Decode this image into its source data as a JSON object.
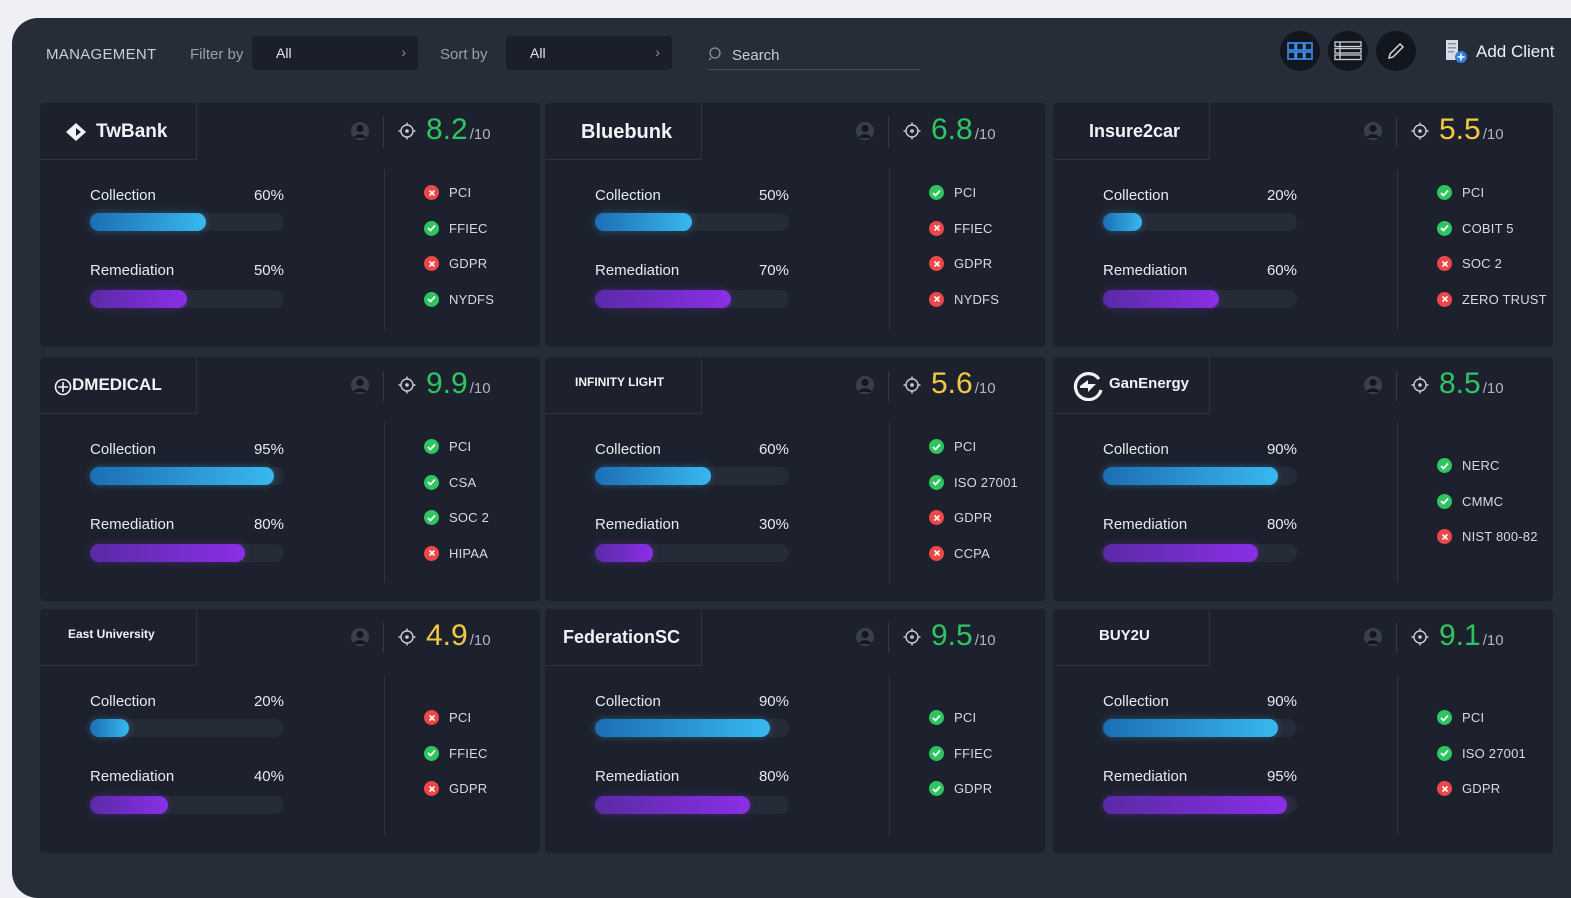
{
  "header": {
    "title": "MANAGEMENT",
    "filter_label": "Filter by",
    "filter_value": "All",
    "sort_label": "Sort by",
    "sort_value": "All",
    "search_placeholder": "Search",
    "add_client": "Add Client"
  },
  "colors": {
    "green": "#2ec561",
    "yellow": "#f3c941",
    "ok": "#2ec561",
    "fail": "#ef4747"
  },
  "score_suffix": "/10",
  "collection_label": "Collection",
  "remediation_label": "Remediation",
  "clients": [
    {
      "logo": "TwBank",
      "score": "8.2",
      "score_color": "green",
      "collection": "60%",
      "remediation": "50%",
      "frameworks": [
        {
          "name": "PCI",
          "status": "fail"
        },
        {
          "name": "FFIEC",
          "status": "ok"
        },
        {
          "name": "GDPR",
          "status": "fail"
        },
        {
          "name": "NYDFS",
          "status": "ok"
        }
      ]
    },
    {
      "logo": "Bluebunk",
      "score": "6.8",
      "score_color": "green",
      "collection": "50%",
      "remediation": "70%",
      "frameworks": [
        {
          "name": "PCI",
          "status": "ok"
        },
        {
          "name": "FFIEC",
          "status": "fail"
        },
        {
          "name": "GDPR",
          "status": "fail"
        },
        {
          "name": "NYDFS",
          "status": "fail"
        }
      ]
    },
    {
      "logo": "Insure2car",
      "score": "5.5",
      "score_color": "yellow",
      "collection": "20%",
      "remediation": "60%",
      "frameworks": [
        {
          "name": "PCI",
          "status": "ok"
        },
        {
          "name": "COBIT 5",
          "status": "ok"
        },
        {
          "name": "SOC 2",
          "status": "fail"
        },
        {
          "name": "ZERO TRUST",
          "status": "fail"
        }
      ]
    },
    {
      "logo": "DMEDICAL",
      "score": "9.9",
      "score_color": "green",
      "collection": "95%",
      "remediation": "80%",
      "frameworks": [
        {
          "name": "PCI",
          "status": "ok"
        },
        {
          "name": "CSA",
          "status": "ok"
        },
        {
          "name": "SOC 2",
          "status": "ok"
        },
        {
          "name": "HIPAA",
          "status": "fail"
        }
      ]
    },
    {
      "logo": "INFINITY LIGHT",
      "score": "5.6",
      "score_color": "yellow",
      "collection": "60%",
      "remediation": "30%",
      "frameworks": [
        {
          "name": "PCI",
          "status": "ok"
        },
        {
          "name": "ISO 27001",
          "status": "ok"
        },
        {
          "name": "GDPR",
          "status": "fail"
        },
        {
          "name": "CCPA",
          "status": "fail"
        }
      ]
    },
    {
      "logo": "GanEnergy",
      "score": "8.5",
      "score_color": "green",
      "collection": "90%",
      "remediation": "80%",
      "frameworks": [
        {
          "name": "NERC",
          "status": "ok"
        },
        {
          "name": "CMMC",
          "status": "ok"
        },
        {
          "name": "NIST 800-82",
          "status": "fail"
        }
      ]
    },
    {
      "logo": "East University",
      "score": "4.9",
      "score_color": "yellow",
      "collection": "20%",
      "remediation": "40%",
      "frameworks": [
        {
          "name": "PCI",
          "status": "fail"
        },
        {
          "name": "FFIEC",
          "status": "ok"
        },
        {
          "name": "GDPR",
          "status": "fail"
        }
      ]
    },
    {
      "logo": "FederationSC",
      "score": "9.5",
      "score_color": "green",
      "collection": "90%",
      "remediation": "80%",
      "frameworks": [
        {
          "name": "PCI",
          "status": "ok"
        },
        {
          "name": "FFIEC",
          "status": "ok"
        },
        {
          "name": "GDPR",
          "status": "ok"
        }
      ]
    },
    {
      "logo": "BUY2U",
      "score": "9.1",
      "score_color": "green",
      "collection": "90%",
      "remediation": "95%",
      "frameworks": [
        {
          "name": "PCI",
          "status": "ok"
        },
        {
          "name": "ISO 27001",
          "status": "ok"
        },
        {
          "name": "GDPR",
          "status": "fail"
        }
      ]
    }
  ]
}
